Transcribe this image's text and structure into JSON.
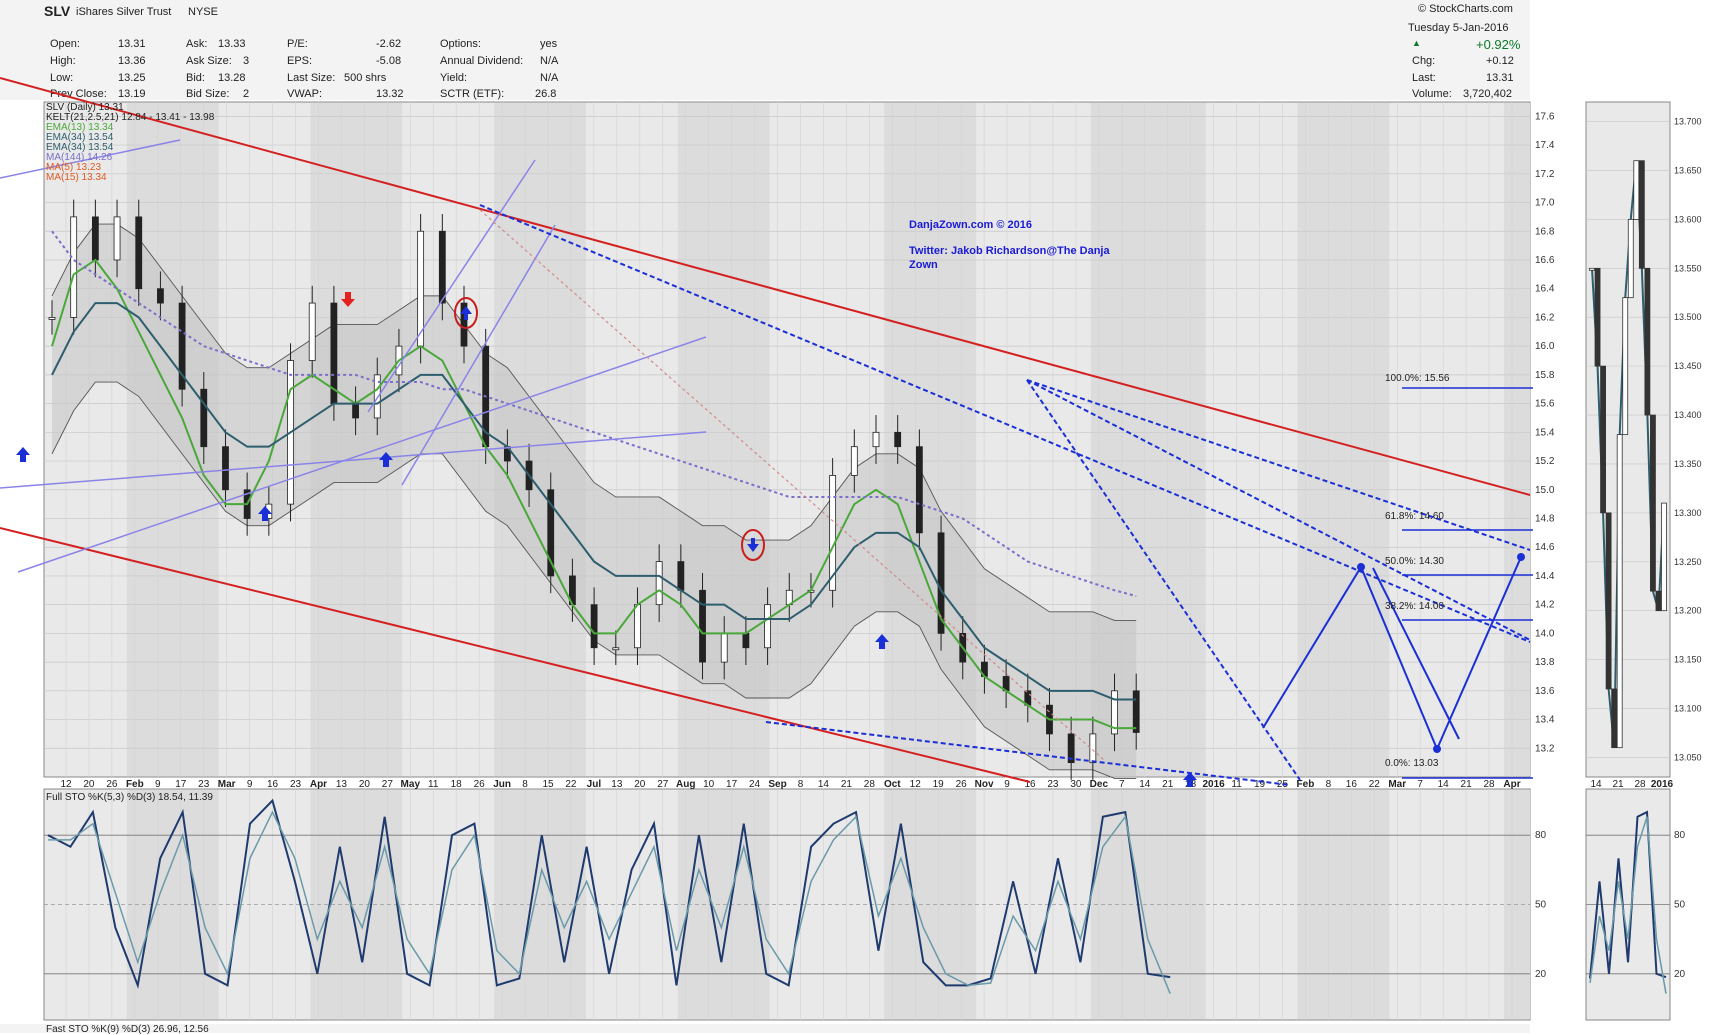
{
  "header": {
    "symbol": "SLV",
    "name": "iShares Silver Trust",
    "exchange": "NYSE",
    "stockcharts": "© StockCharts.com",
    "date": "Tuesday 5-Jan-2016",
    "change_pct": "+0.92%",
    "fields": {
      "open_label": "Open:",
      "open": "13.31",
      "high_label": "High:",
      "high": "13.36",
      "low_label": "Low:",
      "low": "13.25",
      "prev_close_label": "Prev Close:",
      "prev_close": "13.19",
      "ask_label": "Ask:",
      "ask": "13.33",
      "ask_size_label": "Ask Size:",
      "ask_size": "3",
      "bid_label": "Bid:",
      "bid": "13.28",
      "bid_size_label": "Bid Size:",
      "bid_size": "2",
      "pe_label": "P/E:",
      "pe": "-2.62",
      "eps_label": "EPS:",
      "eps": "-5.08",
      "last_size_label": "Last Size:",
      "last_size": "500 shrs",
      "vwap_label": "VWAP:",
      "vwap": "13.32",
      "options_label": "Options:",
      "options": "yes",
      "annual_div_label": "Annual Dividend:",
      "annual_div": "N/A",
      "yield_label": "Yield:",
      "yield": "N/A",
      "sctr_label": "SCTR (ETF):",
      "sctr": "26.8",
      "chg_label": "Chg:",
      "chg": "+0.12",
      "last_label": "Last:",
      "last": "13.31",
      "volume_label": "Volume:",
      "volume": "3,720,402"
    }
  },
  "legend": [
    {
      "text": "SLV (Daily) 13.31",
      "color": "#000000"
    },
    {
      "text": "KELT(21,2.5,21) 12.84 - 13.41 - 13.98",
      "color": "#333333"
    },
    {
      "text": "EMA(13) 13.34",
      "color": "#4aa83a"
    },
    {
      "text": "EMA(34) 13.54",
      "color": "#2e5e6e"
    },
    {
      "text": "EMA(34) 13.54",
      "color": "#2e5e6e"
    },
    {
      "text": "MA(144) 14.26",
      "color": "#7a6fc9"
    },
    {
      "text": "MA(5) 13.23",
      "color": "#e05a20"
    },
    {
      "text": "MA(15) 13.34",
      "color": "#e05a20"
    }
  ],
  "watermark": {
    "line1": "DanjaZown.com © 2016",
    "line2": "Twitter: Jakob Richardson@The Danja",
    "line3": "Zown"
  },
  "fib_labels": [
    "100.0%: 15.56",
    "61.8%: 14.60",
    "50.0%: 14.30",
    "38.2%: 14.00",
    "0.0%: 13.03"
  ],
  "sto_labels": {
    "full": "Full STO %K(5,3) %D(3) 18.54, 11.39",
    "fast": "Fast STO %K(9) %D(3) 26.96, 12.56"
  },
  "chart_data": [
    {
      "type": "line",
      "title": "SLV iShares Silver Trust NYSE",
      "x_ticks": [
        "12",
        "20",
        "26",
        "Feb",
        "9",
        "17",
        "23",
        "Mar",
        "9",
        "16",
        "23",
        "Apr",
        "13",
        "20",
        "27",
        "May",
        "11",
        "18",
        "26",
        "Jun",
        "8",
        "15",
        "22",
        "Jul",
        "13",
        "20",
        "27",
        "Aug",
        "10",
        "17",
        "24",
        "Sep",
        "8",
        "14",
        "21",
        "28",
        "Oct",
        "12",
        "19",
        "26",
        "Nov",
        "9",
        "16",
        "23",
        "30",
        "Dec",
        "7",
        "14",
        "21",
        "28",
        "2016",
        "11",
        "19",
        "25",
        "Feb",
        "8",
        "16",
        "22",
        "Mar",
        "7",
        "14",
        "21",
        "28",
        "Apr"
      ],
      "y_ticks": [
        13.2,
        13.4,
        13.6,
        13.8,
        14.0,
        14.2,
        14.4,
        14.6,
        14.8,
        15.0,
        15.2,
        15.4,
        15.6,
        15.8,
        16.0,
        16.2,
        16.4,
        16.6,
        16.8,
        17.0,
        17.2,
        17.4,
        17.6
      ],
      "ylim": [
        13.0,
        17.7
      ],
      "grid": true,
      "series": [
        {
          "name": "SLV (Daily)",
          "values": [
            16.2,
            16.9,
            16.6,
            16.9,
            16.4,
            16.3,
            15.7,
            15.3,
            15.0,
            14.8,
            14.9,
            15.9,
            16.3,
            15.6,
            15.5,
            15.8,
            16.0,
            16.8,
            16.3,
            16.0,
            15.3,
            15.2,
            15.0,
            14.4,
            14.2,
            13.9,
            13.9,
            14.2,
            14.5,
            14.3,
            13.8,
            14.0,
            13.9,
            14.2,
            14.3,
            14.3,
            15.1,
            15.3,
            15.4,
            15.3,
            14.7,
            14.0,
            13.8,
            13.7,
            13.6,
            13.5,
            13.3,
            13.1,
            13.3,
            13.6,
            13.31
          ]
        },
        {
          "name": "EMA(13)",
          "values": [
            16.0,
            16.5,
            16.6,
            16.4,
            16.1,
            15.8,
            15.5,
            15.1,
            14.9,
            14.9,
            15.2,
            15.7,
            15.8,
            15.7,
            15.6,
            15.7,
            15.9,
            16.0,
            15.9,
            15.6,
            15.3,
            15.1,
            14.8,
            14.5,
            14.2,
            14.0,
            14.0,
            14.2,
            14.3,
            14.2,
            14.0,
            14.0,
            14.0,
            14.1,
            14.2,
            14.3,
            14.6,
            14.9,
            15.0,
            14.9,
            14.5,
            14.1,
            13.9,
            13.7,
            13.6,
            13.5,
            13.4,
            13.4,
            13.4,
            13.34,
            13.34
          ]
        },
        {
          "name": "EMA(34)",
          "values": [
            15.8,
            16.1,
            16.3,
            16.3,
            16.2,
            16.0,
            15.8,
            15.6,
            15.4,
            15.3,
            15.3,
            15.4,
            15.5,
            15.6,
            15.6,
            15.6,
            15.7,
            15.8,
            15.8,
            15.6,
            15.4,
            15.3,
            15.1,
            14.9,
            14.7,
            14.5,
            14.4,
            14.4,
            14.4,
            14.3,
            14.2,
            14.2,
            14.1,
            14.1,
            14.1,
            14.2,
            14.4,
            14.6,
            14.7,
            14.7,
            14.6,
            14.3,
            14.1,
            13.9,
            13.8,
            13.7,
            13.6,
            13.6,
            13.6,
            13.54,
            13.54
          ]
        },
        {
          "name": "MA(144)",
          "values": [
            16.8,
            16.6,
            16.5,
            16.4,
            16.3,
            16.2,
            16.1,
            16.0,
            15.95,
            15.9,
            15.85,
            15.8,
            15.8,
            15.8,
            15.8,
            15.75,
            15.75,
            15.75,
            15.7,
            15.7,
            15.65,
            15.6,
            15.55,
            15.5,
            15.45,
            15.4,
            15.35,
            15.3,
            15.25,
            15.2,
            15.15,
            15.1,
            15.05,
            15.0,
            14.95,
            14.95,
            14.95,
            14.95,
            14.95,
            14.95,
            14.9,
            14.85,
            14.8,
            14.7,
            14.6,
            14.5,
            14.45,
            14.4,
            14.35,
            14.3,
            14.26
          ]
        }
      ]
    },
    {
      "type": "line",
      "title": "Full STO %K(5,3) %D(3)",
      "y_ticks": [
        20,
        50,
        80
      ],
      "ylim": [
        0,
        100
      ],
      "series": [
        {
          "name": "%K",
          "values": [
            80,
            75,
            90,
            40,
            15,
            70,
            90,
            20,
            15,
            85,
            95,
            60,
            20,
            75,
            25,
            88,
            20,
            15,
            80,
            85,
            15,
            18,
            80,
            25,
            75,
            20,
            65,
            85,
            15,
            80,
            25,
            85,
            20,
            15,
            75,
            85,
            90,
            30,
            85,
            25,
            15,
            15,
            18,
            60,
            20,
            70,
            25,
            88,
            90,
            20,
            18.54
          ]
        },
        {
          "name": "%D",
          "values": [
            78,
            78,
            85,
            55,
            25,
            55,
            80,
            40,
            20,
            70,
            90,
            70,
            35,
            60,
            40,
            75,
            35,
            20,
            65,
            80,
            30,
            20,
            65,
            40,
            60,
            35,
            55,
            75,
            30,
            65,
            40,
            75,
            35,
            20,
            60,
            78,
            88,
            45,
            70,
            40,
            20,
            15,
            16,
            45,
            30,
            60,
            35,
            75,
            88,
            35,
            11.39
          ]
        }
      ]
    }
  ]
}
